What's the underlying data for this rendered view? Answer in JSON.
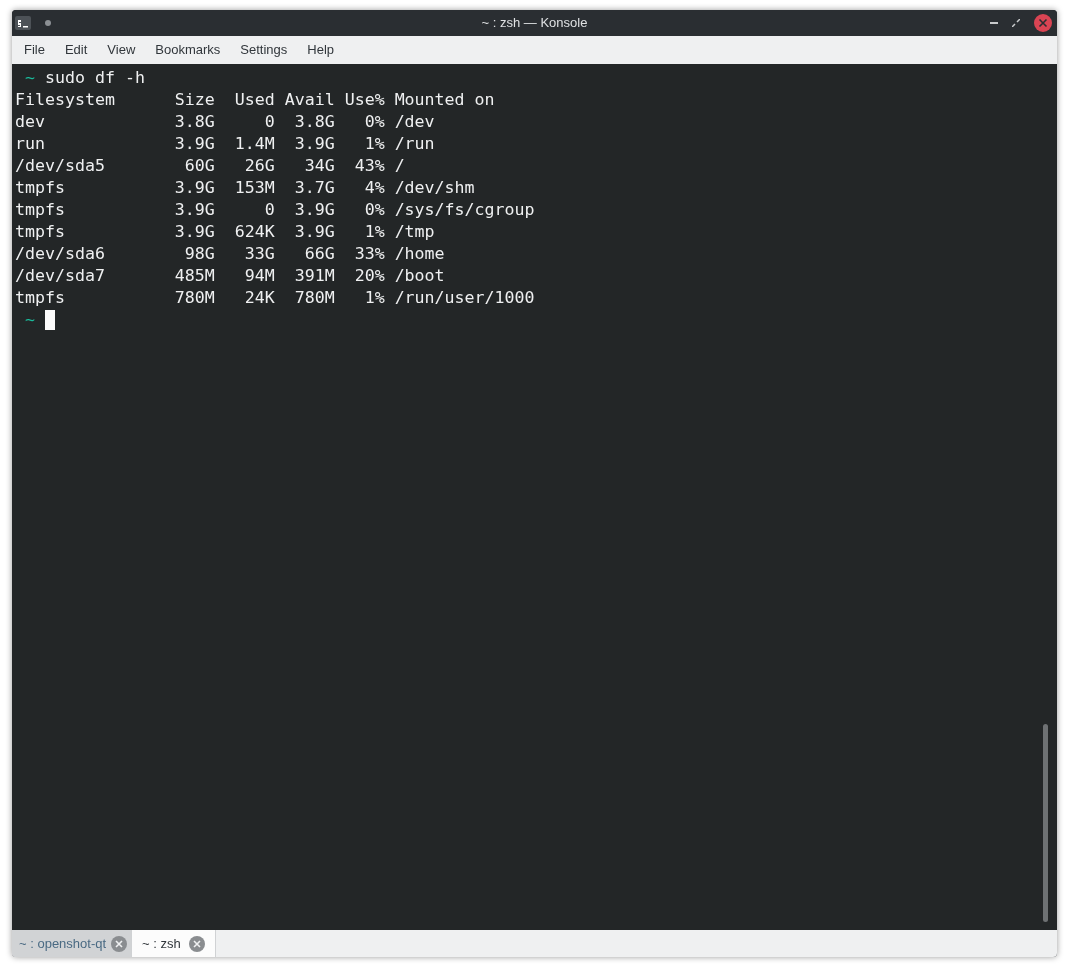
{
  "window": {
    "title": "~ : zsh — Konsole"
  },
  "menu": [
    "File",
    "Edit",
    "View",
    "Bookmarks",
    "Settings",
    "Help"
  ],
  "terminal": {
    "prompt": "~",
    "command": "sudo df -h",
    "lines": [
      "Filesystem      Size  Used Avail Use% Mounted on",
      "dev             3.8G     0  3.8G   0% /dev",
      "run             3.9G  1.4M  3.9G   1% /run",
      "/dev/sda5        60G   26G   34G  43% /",
      "tmpfs           3.9G  153M  3.7G   4% /dev/shm",
      "tmpfs           3.9G     0  3.9G   0% /sys/fs/cgroup",
      "tmpfs           3.9G  624K  3.9G   1% /tmp",
      "/dev/sda6        98G   33G   66G  33% /home",
      "/dev/sda7       485M   94M  391M  20% /boot",
      "tmpfs           780M   24K  780M   1% /run/user/1000"
    ],
    "next_prompt": "~"
  },
  "tabs": [
    {
      "label": "~ : openshot-qt",
      "selected": false
    },
    {
      "label": "~ : zsh",
      "selected": true
    }
  ]
}
